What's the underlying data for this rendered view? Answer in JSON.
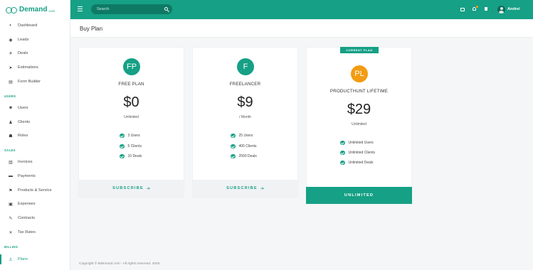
{
  "brand": {
    "name": "Demand",
    "suffix": ".com"
  },
  "sidebar": {
    "items": [
      {
        "label": "Dashboard",
        "icon": "dashboard-icon",
        "glyph": "◐"
      },
      {
        "label": "Leads",
        "icon": "leads-icon",
        "glyph": "◉"
      },
      {
        "label": "Deals",
        "icon": "deals-icon",
        "glyph": "✈"
      },
      {
        "label": "Estimations",
        "icon": "estimations-icon",
        "glyph": "➤"
      },
      {
        "label": "Form Builder",
        "icon": "form-builder-icon",
        "glyph": "▤"
      }
    ],
    "sections": [
      {
        "title": "USERS",
        "items": [
          {
            "label": "Users",
            "icon": "users-icon",
            "glyph": "☻"
          },
          {
            "label": "Clients",
            "icon": "clients-icon",
            "glyph": "♟"
          },
          {
            "label": "Roles",
            "icon": "roles-icon",
            "glyph": "☗"
          }
        ]
      },
      {
        "title": "SALES",
        "items": [
          {
            "label": "Invoices",
            "icon": "invoices-icon",
            "glyph": "▥"
          },
          {
            "label": "Payments",
            "icon": "payments-icon",
            "glyph": "▬"
          },
          {
            "label": "Products & Service",
            "icon": "products-icon",
            "glyph": "⚑"
          },
          {
            "label": "Expenses",
            "icon": "expenses-icon",
            "glyph": "▣"
          },
          {
            "label": "Contracts",
            "icon": "contracts-icon",
            "glyph": "✎"
          },
          {
            "label": "Tax Rates",
            "icon": "tax-rates-icon",
            "glyph": "✕"
          }
        ]
      },
      {
        "title": "BILLING",
        "items": [
          {
            "label": "Plans",
            "icon": "plans-icon",
            "glyph": "♙"
          }
        ]
      }
    ]
  },
  "topbar": {
    "search_placeholder": "Search",
    "user_name": "Andrei"
  },
  "page": {
    "title": "Buy Plan"
  },
  "plans": [
    {
      "initials": "FP",
      "name": "FREE PLAN",
      "price": "$0",
      "period": "Unlimited",
      "avatar_color": "#16a085",
      "features": [
        "3 Users",
        "5 Clients",
        "10 Deals"
      ],
      "action": "SUBSCRIBE",
      "action_icon": "arrow-right-icon"
    },
    {
      "initials": "F",
      "name": "FREELANCER",
      "price": "$9",
      "period": "/ Month",
      "avatar_color": "#16a085",
      "features": [
        "25 Users",
        "400 Clients",
        "2500 Deals"
      ],
      "action": "SUBSCRIBE",
      "action_icon": "arrow-right-icon"
    },
    {
      "initials": "PL",
      "name": "PRODUCTHUNT LIFETIME",
      "price": "$29",
      "period": "Unlimited",
      "avatar_color": "#f39c12",
      "badge": "CURRENT PLAN",
      "features": [
        "Unlimited Users",
        "Unlimited Clients",
        "Unlimited Deals"
      ],
      "action": "UNLIMITED"
    }
  ],
  "footer": {
    "copyright": "Copyright © Bdemand.com - All rights reserved. 2020"
  },
  "colors": {
    "accent": "#16a085",
    "accent_dark": "#0e7a66",
    "orange": "#f39c12",
    "background": "#f4f6f7"
  }
}
